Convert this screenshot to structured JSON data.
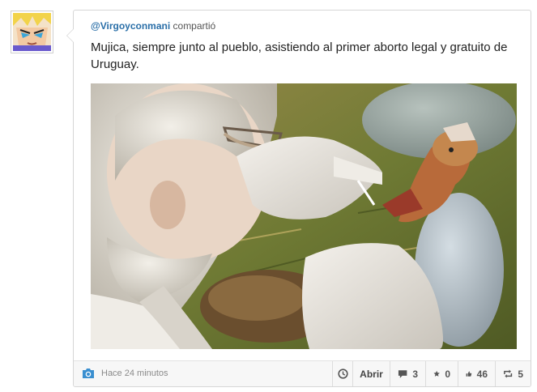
{
  "post": {
    "username": "@Virgoyconmani",
    "action": "compartió",
    "text": "Mujica, siempre junto al pueblo, asistiendo al primer aborto legal y gratuito de Uruguay."
  },
  "footer": {
    "camera_icon": "camera-icon",
    "timestamp": "Hace 24 minutos",
    "open_label": "Abrir",
    "comments_count": "3",
    "stars_count": "0",
    "likes_count": "46",
    "reshares_count": "5"
  },
  "colors": {
    "username": "#2a6fa8",
    "camera": "#3a8fd0",
    "footer_bg": "#f7f7f7"
  }
}
